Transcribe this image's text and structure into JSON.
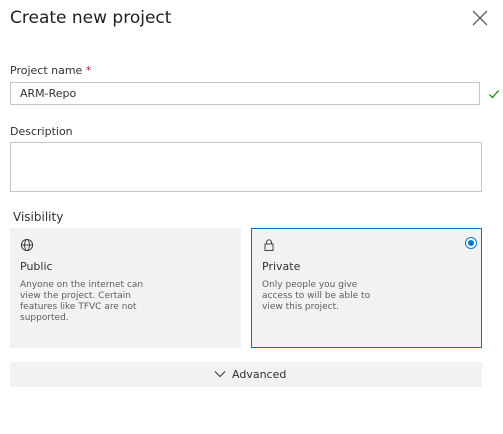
{
  "dialog": {
    "title": "Create new project"
  },
  "project_name": {
    "label": "Project name",
    "required_marker": "*",
    "value": "ARM-Repo",
    "valid": true
  },
  "description": {
    "label": "Description",
    "value": ""
  },
  "visibility": {
    "label": "Visibility",
    "options": [
      {
        "icon": "globe-icon",
        "title": "Public",
        "description": "Anyone on the internet can view the project. Certain features like TFVC are not supported.",
        "selected": false
      },
      {
        "icon": "lock-icon",
        "title": "Private",
        "description": "Only people you give access to will be able to view this project.",
        "selected": true
      }
    ]
  },
  "advanced": {
    "label": "Advanced",
    "icon": "chevron-down-icon"
  },
  "colors": {
    "accent": "#0078d4",
    "success": "#107c10",
    "required": "#a4262c",
    "card_bg": "#f3f2f1"
  }
}
